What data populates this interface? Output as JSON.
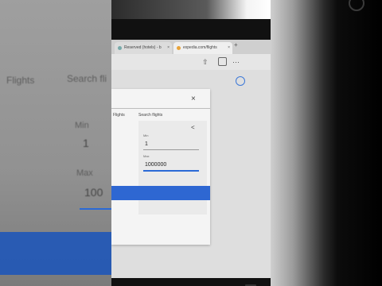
{
  "left_pillar": {
    "tab_flights": "Flights",
    "tab_search": "Search fli",
    "min_label": "Min",
    "min_value": "1",
    "max_label": "Max",
    "max_value": "100"
  },
  "browser": {
    "tabs": [
      {
        "label": "Reserved (hotels) - b",
        "active": false
      },
      {
        "label": "expedia.com/flights",
        "active": true
      }
    ],
    "new_tab": "+",
    "share_icon": "share-icon",
    "tabs_icon": "tabs-icon",
    "more_icon": "more-icon",
    "more_label": "⋯"
  },
  "dialog": {
    "close_label": "×",
    "tab_flights": "Flights",
    "tab_search": "Search flights",
    "min_label": "Min",
    "min_value": "1",
    "max_label": "Max",
    "max_value": "1000000"
  },
  "colors": {
    "accent": "#2e67d2",
    "page_bg": "#dedede"
  }
}
